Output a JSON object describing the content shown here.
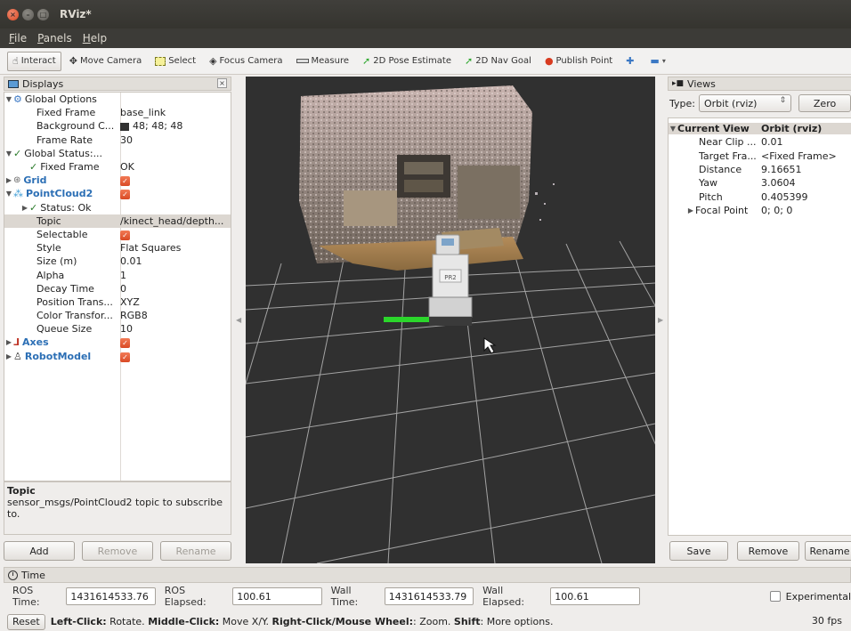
{
  "window": {
    "title": "RViz*"
  },
  "menu": {
    "file": "File",
    "panels": "Panels",
    "help": "Help"
  },
  "toolbar": {
    "interact": "Interact",
    "move_camera": "Move Camera",
    "select": "Select",
    "focus_camera": "Focus Camera",
    "measure": "Measure",
    "pose_estimate": "2D Pose Estimate",
    "nav_goal": "2D Nav Goal",
    "publish_point": "Publish Point"
  },
  "displays": {
    "title": "Displays",
    "rows": [
      {
        "name": "Global Options",
        "value": ""
      },
      {
        "name": "Fixed Frame",
        "value": "base_link"
      },
      {
        "name": "Background C...",
        "value": "48; 48; 48"
      },
      {
        "name": "Frame Rate",
        "value": "30"
      },
      {
        "name": "Global Status:...",
        "value": ""
      },
      {
        "name": "Fixed Frame",
        "value": "OK"
      },
      {
        "name": "Grid",
        "value": ""
      },
      {
        "name": "PointCloud2",
        "value": ""
      },
      {
        "name": "Status: Ok",
        "value": ""
      },
      {
        "name": "Topic",
        "value": "/kinect_head/depth..."
      },
      {
        "name": "Selectable",
        "value": ""
      },
      {
        "name": "Style",
        "value": "Flat Squares"
      },
      {
        "name": "Size (m)",
        "value": "0.01"
      },
      {
        "name": "Alpha",
        "value": "1"
      },
      {
        "name": "Decay Time",
        "value": "0"
      },
      {
        "name": "Position Trans...",
        "value": "XYZ"
      },
      {
        "name": "Color Transfor...",
        "value": "RGB8"
      },
      {
        "name": "Queue Size",
        "value": "10"
      },
      {
        "name": "Axes",
        "value": ""
      },
      {
        "name": "RobotModel",
        "value": ""
      }
    ],
    "description_title": "Topic",
    "description_text": "sensor_msgs/PointCloud2 topic to subscribe to.",
    "add": "Add",
    "remove": "Remove",
    "rename": "Rename",
    "background_color": "#303030"
  },
  "views": {
    "title": "Views",
    "type_label": "Type:",
    "type_value": "Orbit (rviz)",
    "zero": "Zero",
    "rows": [
      {
        "name": "Current View",
        "value": "Orbit (rviz)"
      },
      {
        "name": "Near Clip ...",
        "value": "0.01"
      },
      {
        "name": "Target Fra...",
        "value": "<Fixed Frame>"
      },
      {
        "name": "Distance",
        "value": "9.16651"
      },
      {
        "name": "Yaw",
        "value": "3.0604"
      },
      {
        "name": "Pitch",
        "value": "0.405399"
      },
      {
        "name": "Focal Point",
        "value": "0; 0; 0"
      }
    ],
    "save": "Save",
    "remove": "Remove",
    "rename": "Rename"
  },
  "viewport": {
    "robot_label": "PR2"
  },
  "time": {
    "title": "Time",
    "ros_time_label": "ROS Time:",
    "ros_time": "1431614533.76",
    "ros_elapsed_label": "ROS Elapsed:",
    "ros_elapsed": "100.61",
    "wall_time_label": "Wall Time:",
    "wall_time": "1431614533.79",
    "wall_elapsed_label": "Wall Elapsed:",
    "wall_elapsed": "100.61",
    "experimental": "Experimental"
  },
  "status": {
    "reset": "Reset",
    "left_click": "Left-Click:",
    "left_click_text": " Rotate. ",
    "middle_click": "Middle-Click:",
    "middle_click_text": " Move X/Y. ",
    "right_click": "Right-Click/Mouse Wheel:",
    "right_click_text": ": Zoom. ",
    "shift": "Shift",
    "shift_text": ": More options.",
    "fps": "30 fps"
  }
}
